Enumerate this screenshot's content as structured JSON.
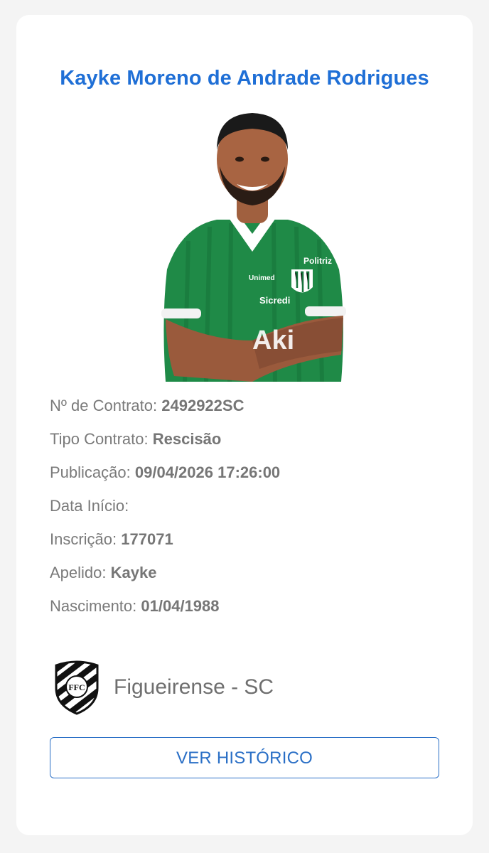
{
  "player": {
    "name": "Kayke Moreno de Andrade Rodrigues"
  },
  "details": {
    "contract_number_label": "Nº de Contrato:",
    "contract_number": "2492922SC",
    "contract_type_label": "Tipo Contrato:",
    "contract_type": "Rescisão",
    "publication_label": "Publicação:",
    "publication": "09/04/2026 17:26:00",
    "start_date_label": "Data Início:",
    "start_date": "",
    "registration_label": "Inscrição:",
    "registration": "177071",
    "nickname_label": "Apelido:",
    "nickname": "Kayke",
    "birth_label": "Nascimento:",
    "birth": "01/04/1988"
  },
  "club": {
    "name": "Figueirense - SC",
    "logo_text": "FFC"
  },
  "actions": {
    "history_label": "VER HISTÓRICO"
  },
  "colors": {
    "accent": "#1f6fd6",
    "jersey": "#1e8a45",
    "text": "#7a7a7a"
  }
}
